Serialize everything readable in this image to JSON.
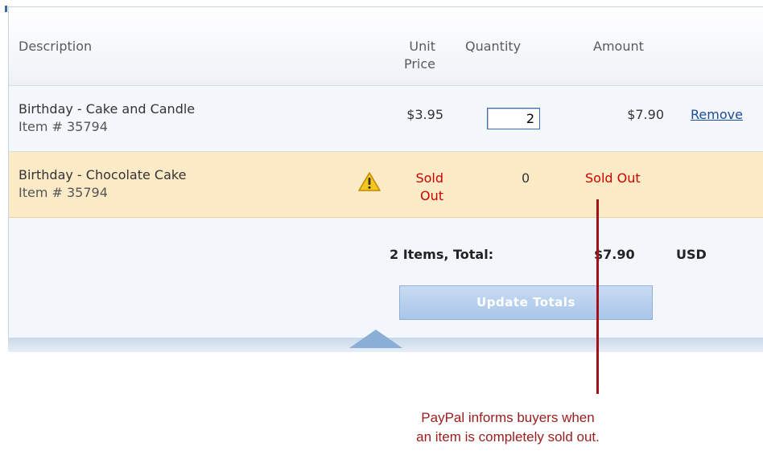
{
  "headers": {
    "description": "Description",
    "unit_price_line1": "Unit",
    "unit_price_line2": "Price",
    "quantity": "Quantity",
    "amount": "Amount"
  },
  "items": [
    {
      "name": "Birthday - Cake and Candle",
      "sku": "Item # 35794",
      "unit_price": "$3.95",
      "quantity": "2",
      "amount": "$7.90",
      "remove_label": "Remove"
    },
    {
      "name": "Birthday - Chocolate Cake",
      "sku": "Item # 35794",
      "unit_price_line1": "Sold",
      "unit_price_line2": "Out",
      "quantity": "0",
      "amount": "Sold Out",
      "status_icon": "warning-icon"
    }
  ],
  "totals": {
    "label": "2 Items, Total:",
    "amount": "$7.90",
    "currency": "USD"
  },
  "update_button_label": "Update Totals",
  "callout": {
    "line1": "PayPal informs buyers when",
    "line2": "an item is completely sold out."
  },
  "colors": {
    "sold_out": "#cc0000",
    "callout": "#9b1c1c",
    "row_highlight": "#fdebc8",
    "link": "#1a4d9c"
  }
}
